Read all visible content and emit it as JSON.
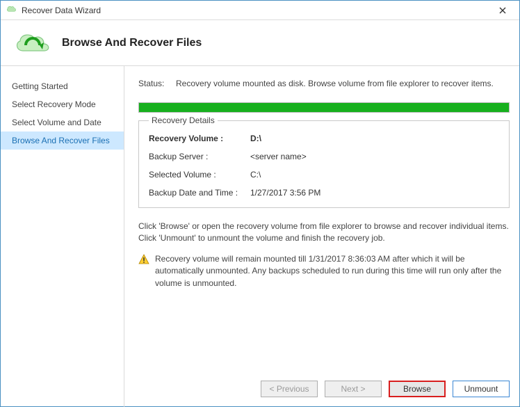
{
  "window": {
    "title": "Recover Data Wizard"
  },
  "header": {
    "title": "Browse And Recover Files"
  },
  "sidebar": {
    "items": [
      {
        "label": "Getting Started"
      },
      {
        "label": "Select Recovery Mode"
      },
      {
        "label": "Select Volume and Date"
      },
      {
        "label": "Browse And Recover Files"
      }
    ],
    "active_index": 3
  },
  "status": {
    "label": "Status:",
    "text": "Recovery volume mounted as disk. Browse volume from file explorer to recover items."
  },
  "progress": {
    "percent": 100,
    "color": "#17b01e"
  },
  "recovery_details": {
    "legend": "Recovery Details",
    "rows": [
      {
        "label": "Recovery Volume :",
        "value": "D:\\",
        "bold": true
      },
      {
        "label": "Backup Server :",
        "value": "<server name>"
      },
      {
        "label": "Selected Volume :",
        "value": "C:\\"
      },
      {
        "label": "Backup Date and Time :",
        "value": "1/27/2017 3:56 PM"
      }
    ]
  },
  "instructions": "Click 'Browse' or open the recovery volume from file explorer to browse and recover individual items. Click 'Unmount' to unmount the volume and finish the recovery job.",
  "warning": {
    "text": "Recovery volume will remain mounted till 1/31/2017 8:36:03 AM after which it will be automatically unmounted. Any backups scheduled to run during this time will run only after the volume is unmounted."
  },
  "buttons": {
    "previous": "< Previous",
    "next": "Next >",
    "browse": "Browse",
    "unmount": "Unmount"
  }
}
